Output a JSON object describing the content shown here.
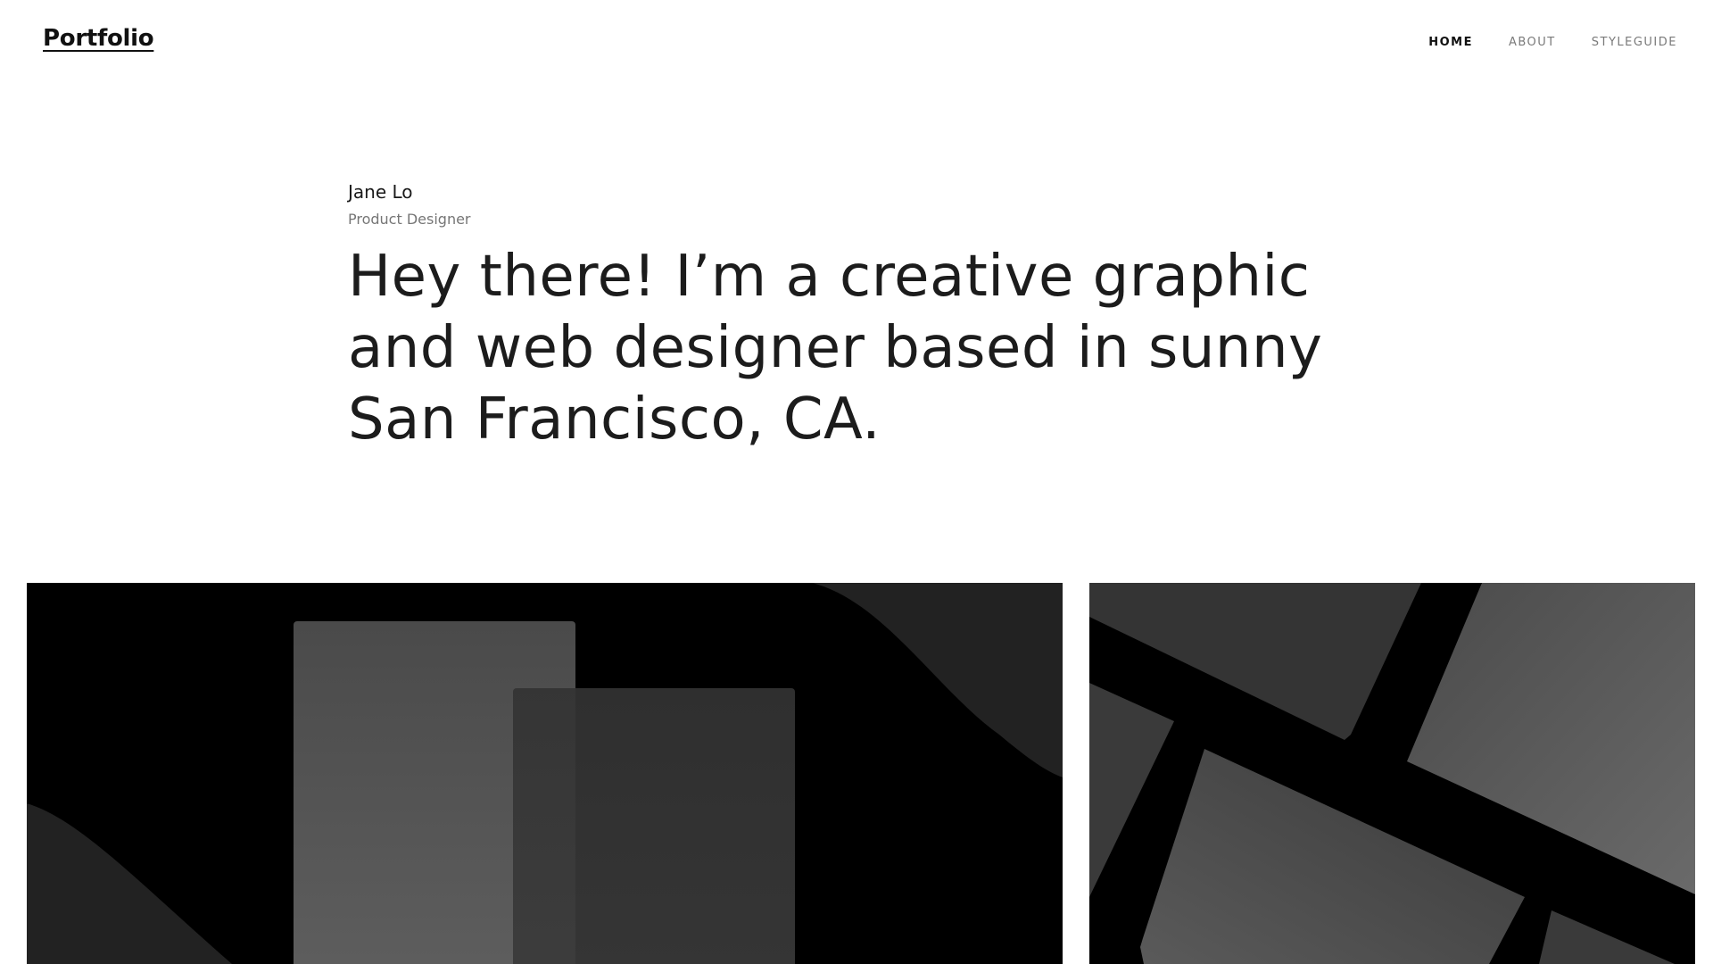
{
  "header": {
    "logo": "Portfolio",
    "nav": [
      {
        "label": "HOME",
        "active": true
      },
      {
        "label": "ABOUT",
        "active": false
      },
      {
        "label": "STYLEGUIDE",
        "active": false
      }
    ]
  },
  "intro": {
    "name": "Jane Lo",
    "role": "Product Designer",
    "headline": "Hey there! I’m a creative graphic and web designer based in sunny San Francisco, CA."
  },
  "projects": [
    {
      "thumbnail": "abstract-rectangles-and-waves"
    },
    {
      "thumbnail": "abstract-tilted-cards"
    }
  ],
  "colors": {
    "background": "#ffffff",
    "text": "#1a1a1a",
    "muted": "#767676",
    "tile_background": "#000000"
  }
}
